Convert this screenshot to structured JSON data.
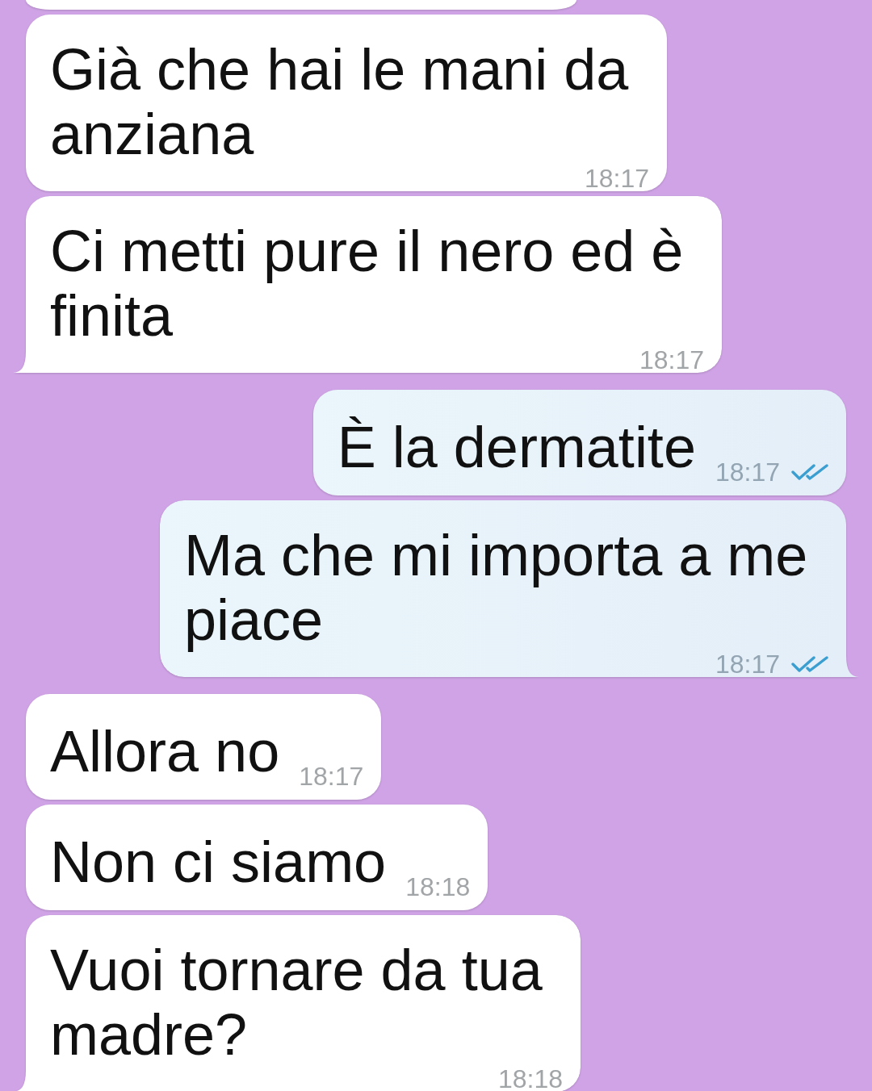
{
  "partial_bubble_above": {
    "kind": "incoming"
  },
  "messages": [
    {
      "kind": "incoming",
      "text": "Già che hai le mani da anziana",
      "time": "18:17",
      "tail": false
    },
    {
      "kind": "incoming",
      "text": "Ci metti pure il nero ed è finita",
      "time": "18:17",
      "tail": true
    },
    {
      "kind": "outgoing",
      "text": "È la dermatite",
      "time": "18:17",
      "read": true,
      "tail": false
    },
    {
      "kind": "outgoing",
      "text": "Ma che mi importa a me piace",
      "time": "18:17",
      "read": true,
      "tail": true
    },
    {
      "kind": "incoming",
      "text": "Allora no",
      "time": "18:17",
      "tail": false
    },
    {
      "kind": "incoming",
      "text": "Non ci siamo",
      "time": "18:18",
      "tail": false
    },
    {
      "kind": "incoming",
      "text": "Vuoi tornare da tua madre?",
      "time": "18:18",
      "tail": true
    }
  ]
}
